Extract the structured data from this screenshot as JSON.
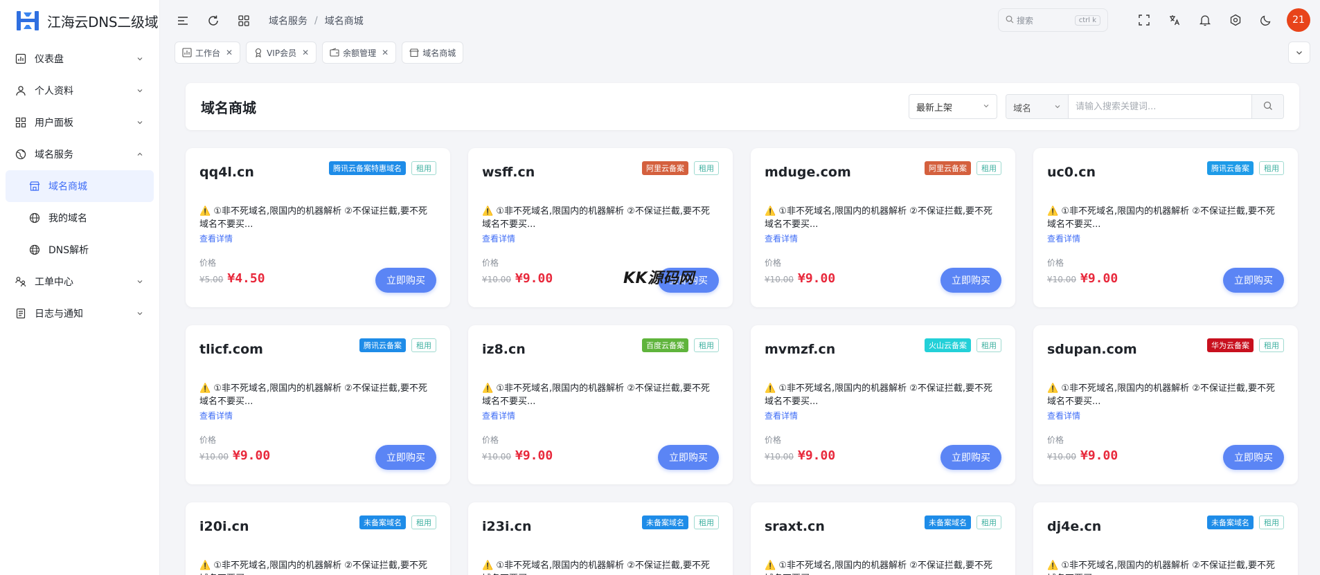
{
  "app": {
    "title": "江海云DNS二级域"
  },
  "sidebar": {
    "items": [
      {
        "label": "仪表盘",
        "icon": "dashboard-icon",
        "expanded": false
      },
      {
        "label": "个人资料",
        "icon": "user-icon",
        "expanded": false
      },
      {
        "label": "用户面板",
        "icon": "grid-icon",
        "expanded": false
      },
      {
        "label": "域名服务",
        "icon": "globe-icon",
        "expanded": true,
        "children": [
          {
            "label": "域名商城",
            "icon": "store-icon",
            "active": true
          },
          {
            "label": "我的域名",
            "icon": "globe-icon"
          },
          {
            "label": "DNS解析",
            "icon": "globe-icon"
          }
        ]
      },
      {
        "label": "工单中心",
        "icon": "ticket-icon",
        "expanded": false
      },
      {
        "label": "日志与通知",
        "icon": "log-icon",
        "expanded": false
      }
    ]
  },
  "topbar": {
    "breadcrumb": [
      "域名服务",
      "域名商城"
    ],
    "search_placeholder": "搜索",
    "search_kbd": "ctrl k",
    "avatar_text": "21"
  },
  "tabs": [
    {
      "label": "工作台",
      "icon": "workbench-icon"
    },
    {
      "label": "VIP会员",
      "icon": "vip-icon"
    },
    {
      "label": "余额管理",
      "icon": "wallet-icon"
    },
    {
      "label": "域名商城",
      "icon": "store-icon"
    }
  ],
  "main": {
    "title": "域名商城",
    "sort_value": "最新上架",
    "type_value": "域名",
    "keyword_placeholder": "请输入搜索关键词..."
  },
  "card_common": {
    "desc": "⚠️ ①非不死域名,限国内的机器解析 ②不保证拦截,要不死域名不要买...",
    "detail": "查看详情",
    "price_label": "价格",
    "buy": "立即购买",
    "rent": "租用"
  },
  "colors": {
    "腾讯": "#1e8ce8",
    "阿里": "#d4603e",
    "百度": "#5fb43c",
    "火山": "#23d0d8",
    "华为": "#c8101e",
    "未备案": "#1e8ce8",
    "primary": "#5b85f5",
    "price": "#e8293c"
  },
  "cards": [
    {
      "domain": "qq4l.cn",
      "tag": "腾讯云备案特惠域名",
      "tag_color": "#1e8ce8",
      "old": "¥5.00",
      "price": "¥4.50"
    },
    {
      "domain": "wsff.cn",
      "tag": "阿里云备案",
      "tag_color": "#d4603e",
      "old": "¥10.00",
      "price": "¥9.00"
    },
    {
      "domain": "mduge.com",
      "tag": "阿里云备案",
      "tag_color": "#d4603e",
      "old": "¥10.00",
      "price": "¥9.00"
    },
    {
      "domain": "uc0.cn",
      "tag": "腾讯云备案",
      "tag_color": "#1e9be8",
      "old": "¥10.00",
      "price": "¥9.00"
    },
    {
      "domain": "tlicf.com",
      "tag": "腾讯云备案",
      "tag_color": "#1e8ce8",
      "old": "¥10.00",
      "price": "¥9.00"
    },
    {
      "domain": "iz8.cn",
      "tag": "百度云备案",
      "tag_color": "#5fb43c",
      "old": "¥10.00",
      "price": "¥9.00"
    },
    {
      "domain": "mvmzf.cn",
      "tag": "火山云备案",
      "tag_color": "#23d0d8",
      "old": "¥10.00",
      "price": "¥9.00"
    },
    {
      "domain": "sdupan.com",
      "tag": "华为云备案",
      "tag_color": "#c8101e",
      "old": "¥10.00",
      "price": "¥9.00"
    },
    {
      "domain": "i20i.cn",
      "tag": "未备案域名",
      "tag_color": "#1e8ce8",
      "partial": true
    },
    {
      "domain": "i23i.cn",
      "tag": "未备案域名",
      "tag_color": "#1e8ce8",
      "partial": true
    },
    {
      "domain": "sraxt.cn",
      "tag": "未备案域名",
      "tag_color": "#1e8ce8",
      "partial": true
    },
    {
      "domain": "dj4e.cn",
      "tag": "未备案域名",
      "tag_color": "#1e8ce8",
      "partial": true
    }
  ],
  "watermark": "KK源码网"
}
